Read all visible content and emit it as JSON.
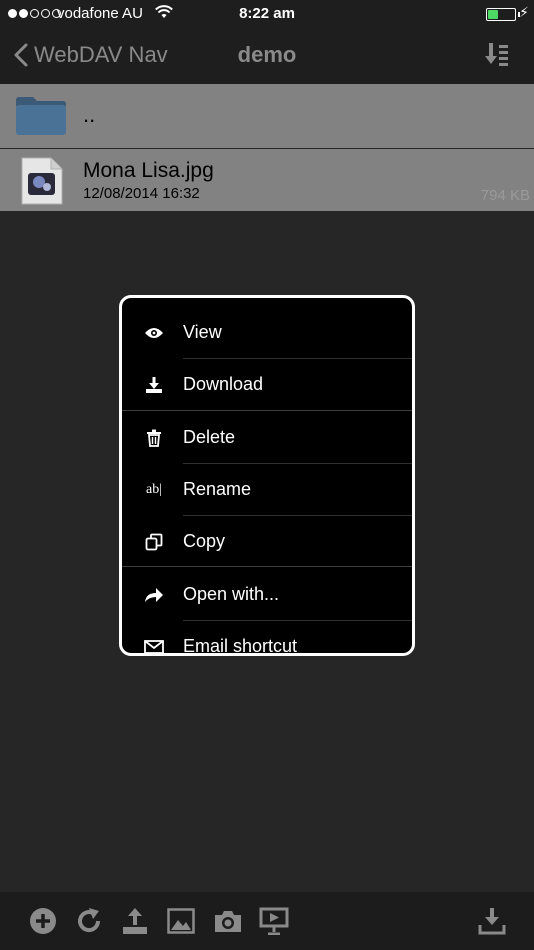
{
  "status_bar": {
    "carrier": "vodafone AU",
    "time": "8:22 am",
    "signal_bars_filled": 2,
    "battery_level": 0.4
  },
  "nav": {
    "back_label": "WebDAV Nav",
    "title": "demo"
  },
  "files": {
    "parent": {
      "label": ".."
    },
    "items": [
      {
        "name": "Mona Lisa.jpg",
        "date": "12/08/2014 16:32",
        "size": "794 KB"
      }
    ]
  },
  "menu": {
    "items": [
      {
        "label": "View",
        "icon": "eye-icon"
      },
      {
        "label": "Download",
        "icon": "download-icon"
      },
      {
        "label": "Delete",
        "icon": "trash-icon"
      },
      {
        "label": "Rename",
        "icon": "rename-icon",
        "icon_text": "ab|"
      },
      {
        "label": "Copy",
        "icon": "copy-icon"
      },
      {
        "label": "Open with...",
        "icon": "share-arrow-icon"
      },
      {
        "label": "Email shortcut",
        "icon": "mail-icon"
      }
    ]
  },
  "toolbar": {
    "buttons": [
      "add-icon",
      "refresh-icon",
      "upload-icon",
      "photo-library-icon",
      "camera-icon",
      "present-icon",
      "download-icon"
    ]
  },
  "colors": {
    "background": "#262626",
    "bar_background": "#1e1e1e",
    "row_background": "#828282",
    "accent_gray": "#8a8a8a",
    "battery": "#4cd964",
    "menu_background": "#000000"
  }
}
